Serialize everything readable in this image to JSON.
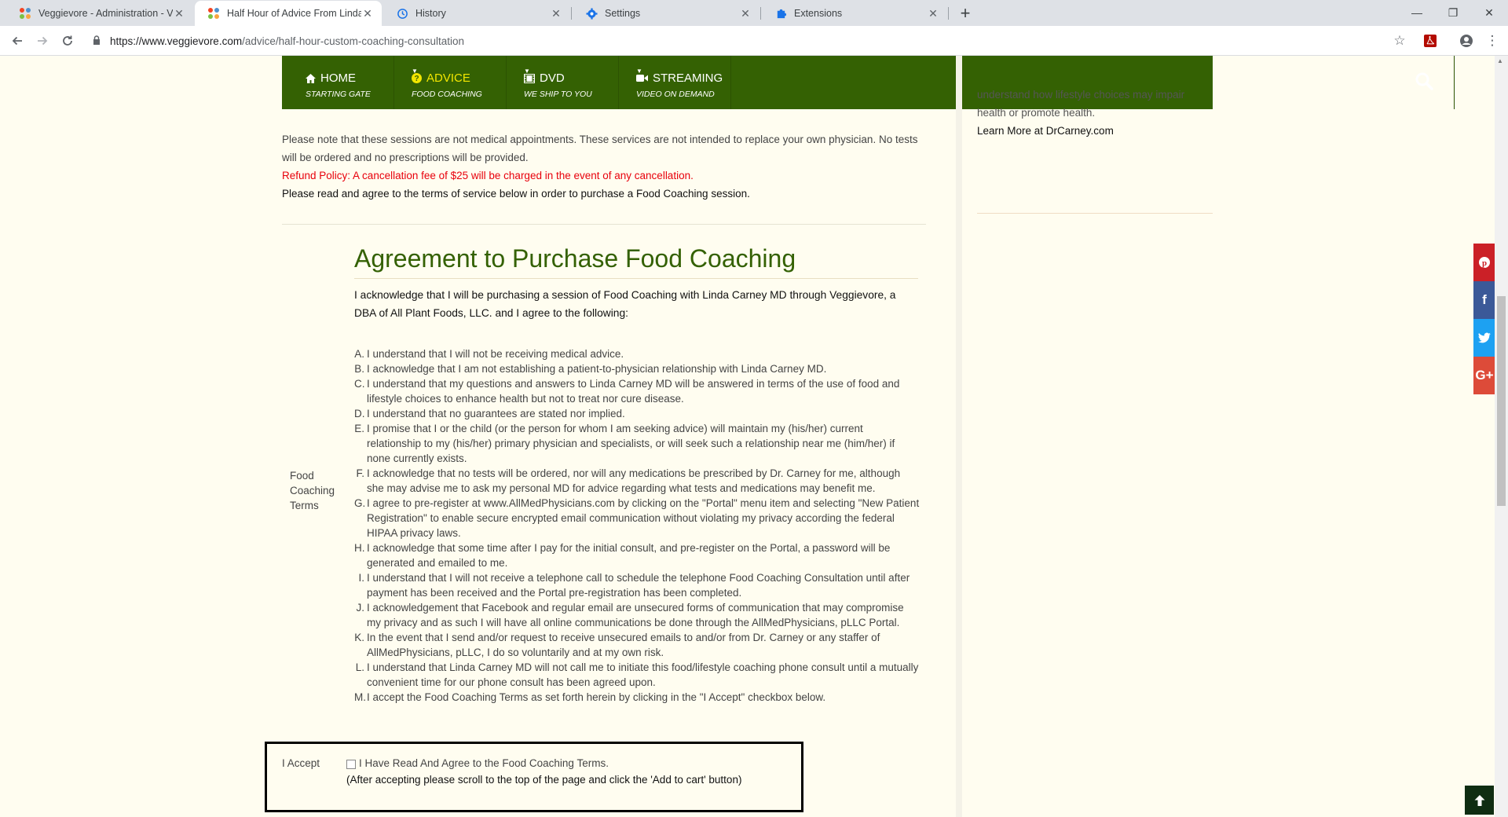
{
  "browser": {
    "tabs": [
      {
        "title": "Veggievore - Administration - Vir",
        "active": false
      },
      {
        "title": "Half Hour of Advice From Linda C",
        "active": true
      },
      {
        "title": "History",
        "active": false
      },
      {
        "title": "Settings",
        "active": false
      },
      {
        "title": "Extensions",
        "active": false
      }
    ],
    "url_host": "https://www.veggievore.com",
    "url_path": "/advice/half-hour-custom-coaching-consultation"
  },
  "nav": {
    "items": [
      {
        "label": "HOME",
        "sub": "STARTING GATE",
        "icon": "home-icon"
      },
      {
        "label": "ADVICE",
        "sub": "FOOD COACHING",
        "icon": "question-circle-icon",
        "active": true
      },
      {
        "label": "DVD",
        "sub": "WE SHIP TO YOU",
        "icon": "film-icon"
      },
      {
        "label": "STREAMING",
        "sub": "VIDEO ON DEMAND",
        "icon": "video-camera-icon"
      }
    ]
  },
  "content": {
    "note": "Please note that these sessions are not medical appointments. These services are not intended to replace your own physician. No tests will be ordered and no prescriptions will be provided.",
    "refund": "Refund Policy: A cancellation fee of $25 will be charged in the event of any cancellation.",
    "agree": "Please read and agree to the terms of service below in order to purchase a Food Coaching session."
  },
  "agreement": {
    "title": "Agreement to Purchase Food Coaching",
    "intro": "I acknowledge that I will be purchasing a session of Food Coaching with Linda Carney MD through Veggievore, a DBA of All Plant Foods, LLC. and I agree to the following:",
    "terms_label": "Food Coaching Terms",
    "terms": [
      {
        "letter": "A.",
        "text": "I understand that I will not be receiving medical advice."
      },
      {
        "letter": "B.",
        "text": "I acknowledge that I am not establishing a patient-to-physician relationship with Linda Carney MD."
      },
      {
        "letter": "C.",
        "text": "I understand that my questions and answers to Linda Carney MD will be answered in terms of the use of food and lifestyle choices to enhance health but not to treat nor cure disease."
      },
      {
        "letter": "D.",
        "text": "I understand that no guarantees are stated nor implied."
      },
      {
        "letter": "E.",
        "text": "I promise that I or the child (or the person for whom I am seeking advice) will maintain my (his/her) current relationship to my (his/her) primary physician and specialists, or will seek such a relationship near me (him/her) if none currently exists."
      },
      {
        "letter": "F.",
        "text": "I acknowledge that no tests will be ordered, nor will any medications be prescribed by Dr. Carney for me, although she may advise me to ask my personal MD for advice regarding what tests and medications may benefit me."
      },
      {
        "letter": "G.",
        "text": "I agree to pre-register at www.AllMedPhysicians.com by clicking on the \"Portal\" menu item and selecting \"New Patient Registration\" to enable secure encrypted email communication without violating my privacy according the federal HIPAA privacy laws."
      },
      {
        "letter": "H.",
        "text": "I acknowledge that some time after I pay for the initial consult, and pre-register on the Portal, a password will be generated and emailed to me."
      },
      {
        "letter": "I.",
        "text": "I understand that I will not receive a telephone call to schedule the telephone Food Coaching Consultation until after payment has been received and the Portal pre-registration has been completed."
      },
      {
        "letter": "J.",
        "text": "I acknowledgement that Facebook and regular email are unsecured forms of communication that may compromise my privacy and as such I will have all online communications be done through the AllMedPhysicians, pLLC Portal."
      },
      {
        "letter": "K.",
        "text": "In the event that I send and/or request to receive unsecured emails to and/or from Dr. Carney or any staffer of AllMedPhysicians, pLLC, I do so voluntarily and at my own risk."
      },
      {
        "letter": "L.",
        "text": "I understand that Linda Carney MD will not call me to initiate this food/lifestyle coaching phone consult until a mutually convenient time for our phone consult has been agreed upon."
      },
      {
        "letter": "M.",
        "text": "I accept the Food Coaching Terms as set forth herein by clicking in the \"I Accept\" checkbox below."
      }
    ],
    "accept_label": "I Accept",
    "accept_text": "I Have Read And Agree to the Food Coaching Terms.",
    "accept_note": "(After accepting please scroll to the top of the page and click the 'Add to cart' button)"
  },
  "sidebar": {
    "text": "understand how lifestyle choices may impair health or promote health.",
    "link": "Learn More at DrCarney.com"
  },
  "social": [
    {
      "name": "pinterest",
      "glyph": "P",
      "color": "#cb2027"
    },
    {
      "name": "facebook",
      "glyph": "f",
      "color": "#3b5998"
    },
    {
      "name": "twitter",
      "glyph": "t",
      "color": "#1da1f2"
    },
    {
      "name": "google-plus",
      "glyph": "G+",
      "color": "#dd4b39"
    }
  ],
  "colors": {
    "nav_bg": "#346103",
    "accent_yellow": "#f2e600",
    "refund_red": "#e8000b"
  }
}
